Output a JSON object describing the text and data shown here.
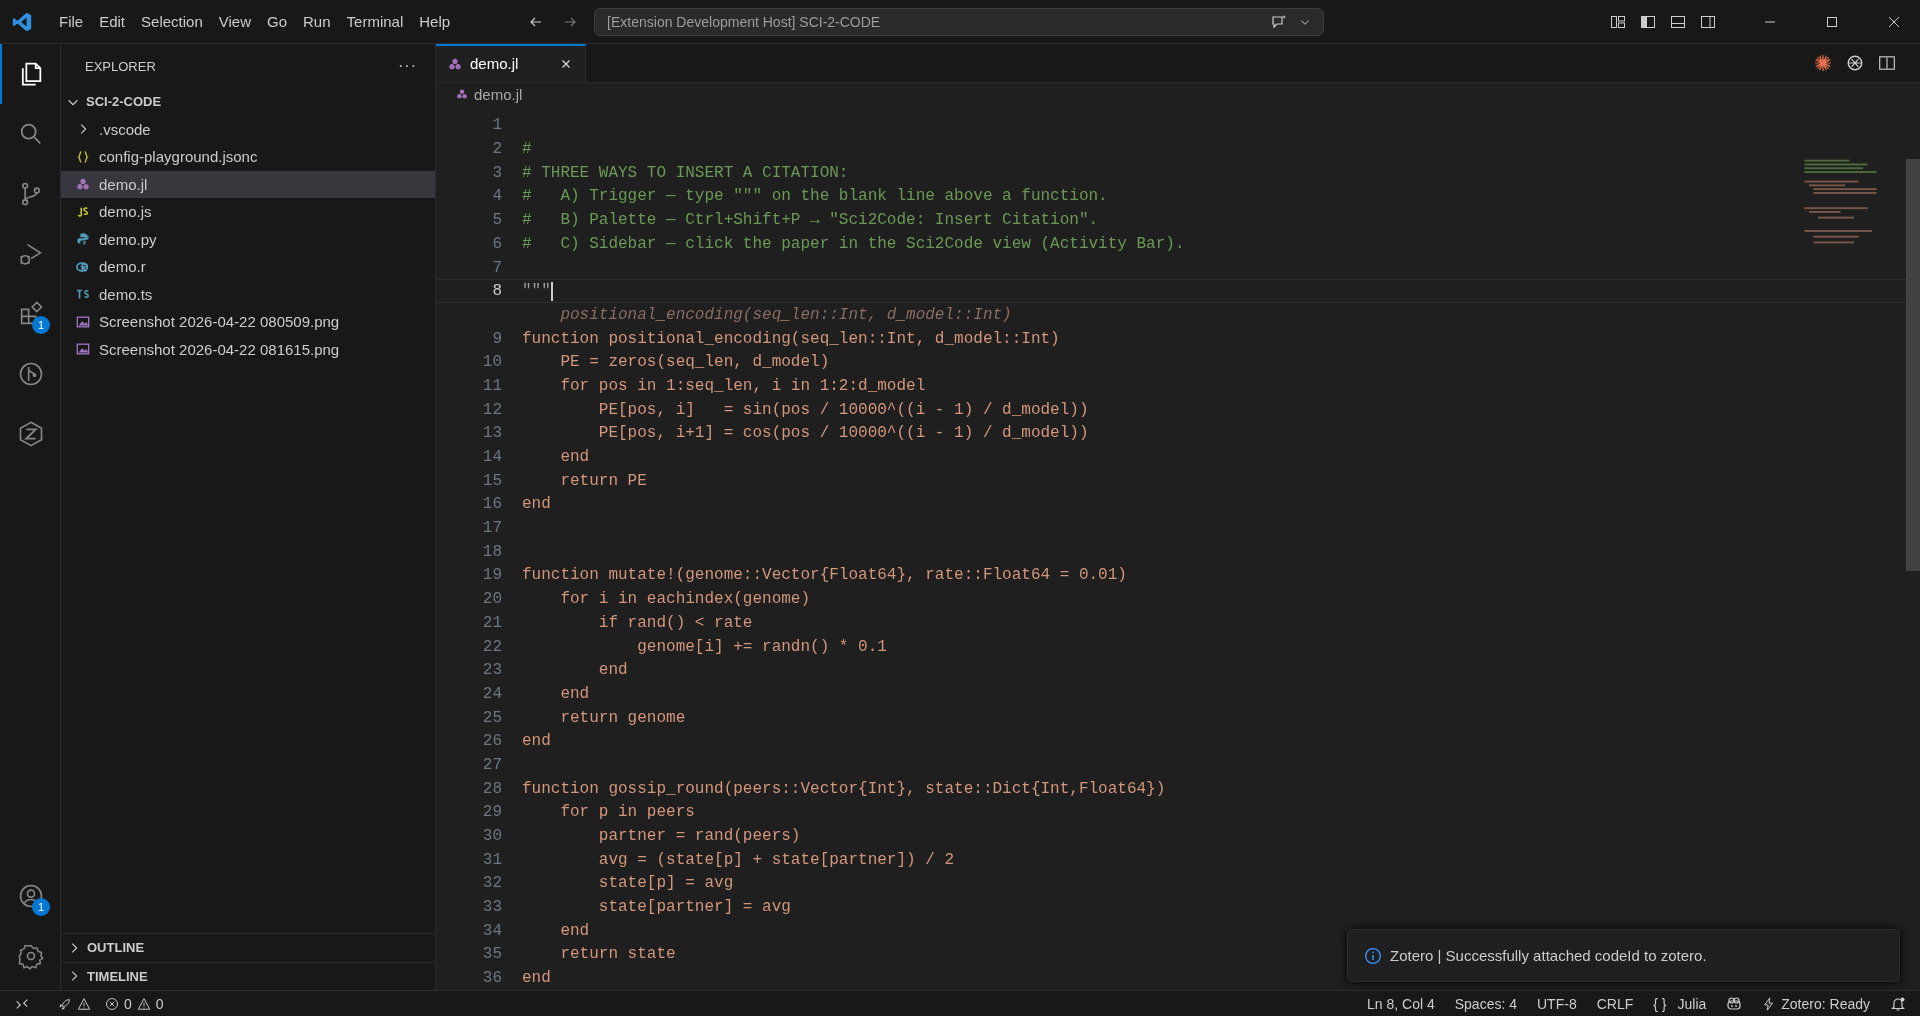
{
  "menu": [
    "File",
    "Edit",
    "Selection",
    "View",
    "Go",
    "Run",
    "Terminal",
    "Help"
  ],
  "command_center": "[Extension Development Host] SCI-2-CODE",
  "activity_bar": [
    {
      "kind": "explorer",
      "selected": true
    },
    {
      "kind": "search",
      "selected": false
    },
    {
      "kind": "source-control",
      "selected": false
    },
    {
      "kind": "run-debug",
      "selected": false
    },
    {
      "kind": "extensions",
      "selected": false,
      "badge": "1"
    },
    {
      "kind": "graph",
      "selected": false
    },
    {
      "kind": "zotero",
      "selected": false
    }
  ],
  "activity_bottom": [
    {
      "kind": "accounts",
      "badge": "1"
    },
    {
      "kind": "settings"
    }
  ],
  "sidebar": {
    "title": "EXPLORER",
    "more": "···",
    "folder": {
      "name": "SCI-2-CODE",
      "expanded": true,
      "children": [
        {
          "name": ".vscode",
          "kind": "folder",
          "expanded": false,
          "selected": false
        },
        {
          "name": "config-playground.jsonc",
          "kind": "jsonc",
          "selected": false
        },
        {
          "name": "demo.jl",
          "kind": "julia",
          "selected": true
        },
        {
          "name": "demo.js",
          "kind": "js",
          "selected": false
        },
        {
          "name": "demo.py",
          "kind": "python",
          "selected": false
        },
        {
          "name": "demo.r",
          "kind": "r",
          "selected": false
        },
        {
          "name": "demo.ts",
          "kind": "ts",
          "selected": false
        },
        {
          "name": "Screenshot 2026-04-22 080509.png",
          "kind": "image",
          "selected": false
        },
        {
          "name": "Screenshot 2026-04-22 081615.png",
          "kind": "image",
          "selected": false
        }
      ]
    },
    "sections": [
      {
        "name": "OUTLINE",
        "expanded": false
      },
      {
        "name": "TIMELINE",
        "expanded": false
      }
    ]
  },
  "tabs": [
    {
      "label": "demo.jl",
      "selected": true
    }
  ],
  "breadcrumb": "demo.jl",
  "lines": [
    {
      "number": "1"
    },
    {
      "number": "2",
      "kind": "comment",
      "text": "#"
    },
    {
      "number": "3",
      "kind": "comment",
      "text": "# THREE WAYS TO INSERT A CITATION:"
    },
    {
      "number": "4",
      "kind": "comment",
      "text": "#   A) Trigger — type \"\"\" on the blank line above a function."
    },
    {
      "number": "5",
      "kind": "comment",
      "text": "#   B) Palette — Ctrl+Shift+P → \"Sci2Code: Insert Citation\"."
    },
    {
      "number": "6",
      "kind": "comment",
      "text": "#   C) Sidebar — click the paper in the Sci2Code view (Activity Bar)."
    },
    {
      "number": "7"
    },
    {
      "number": "8",
      "kind": "string",
      "text": "\"\"\"",
      "current": true
    },
    {
      "kind": "ghost",
      "text": "    positional_encoding(seq_len::Int, d_model::Int)"
    },
    {
      "number": "9",
      "kind": "code",
      "text": "function positional_encoding(seq_len::Int, d_model::Int)"
    },
    {
      "number": "10",
      "kind": "code",
      "text": "    PE = zeros(seq_len, d_model)"
    },
    {
      "number": "11",
      "kind": "code",
      "text": "    for pos in 1:seq_len, i in 1:2:d_model"
    },
    {
      "number": "12",
      "kind": "code",
      "text": "        PE[pos, i]   = sin(pos / 10000^((i - 1) / d_model))"
    },
    {
      "number": "13",
      "kind": "code",
      "text": "        PE[pos, i+1] = cos(pos / 10000^((i - 1) / d_model))"
    },
    {
      "number": "14",
      "kind": "code",
      "text": "    end"
    },
    {
      "number": "15",
      "kind": "code",
      "text": "    return PE"
    },
    {
      "number": "16",
      "kind": "code",
      "text": "end"
    },
    {
      "number": "17"
    },
    {
      "number": "18"
    },
    {
      "number": "19",
      "kind": "code",
      "text": "function mutate!(genome::Vector{Float64}, rate::Float64 = 0.01)"
    },
    {
      "number": "20",
      "kind": "code",
      "text": "    for i in eachindex(genome)"
    },
    {
      "number": "21",
      "kind": "code",
      "text": "        if rand() < rate"
    },
    {
      "number": "22",
      "kind": "code",
      "text": "            genome[i] += randn() * 0.1"
    },
    {
      "number": "23",
      "kind": "code",
      "text": "        end"
    },
    {
      "number": "24",
      "kind": "code",
      "text": "    end"
    },
    {
      "number": "25",
      "kind": "code",
      "text": "    return genome"
    },
    {
      "number": "26",
      "kind": "code",
      "text": "end"
    },
    {
      "number": "27"
    },
    {
      "number": "28",
      "kind": "code",
      "text": "function gossip_round(peers::Vector{Int}, state::Dict{Int,Float64})"
    },
    {
      "number": "29",
      "kind": "code",
      "text": "    for p in peers"
    },
    {
      "number": "30",
      "kind": "code",
      "text": "        partner = rand(peers)"
    },
    {
      "number": "31",
      "kind": "code",
      "text": "        avg = (state[p] + state[partner]) / 2"
    },
    {
      "number": "32",
      "kind": "code",
      "text": "        state[p] = avg"
    },
    {
      "number": "33",
      "kind": "code",
      "text": "        state[partner] = avg"
    },
    {
      "number": "34",
      "kind": "code",
      "text": "    end"
    },
    {
      "number": "35",
      "kind": "code",
      "text": "    return state"
    },
    {
      "number": "36",
      "kind": "code",
      "text": "end"
    }
  ],
  "notification": {
    "text": "Zotero | Successfully attached codeId to zotero."
  },
  "status_bar": {
    "errors": "0",
    "warnings": "0",
    "right": [
      {
        "kind": "text",
        "text": "Ln 8, Col 4"
      },
      {
        "kind": "text",
        "text": "Spaces: 4"
      },
      {
        "kind": "text",
        "text": "UTF-8"
      },
      {
        "kind": "text",
        "text": "CRLF"
      },
      {
        "kind": "language",
        "icon": "{ }",
        "text": "Julia"
      },
      {
        "kind": "copilot"
      },
      {
        "kind": "zotero",
        "text": "Zotero: Ready"
      },
      {
        "kind": "bell"
      }
    ]
  }
}
